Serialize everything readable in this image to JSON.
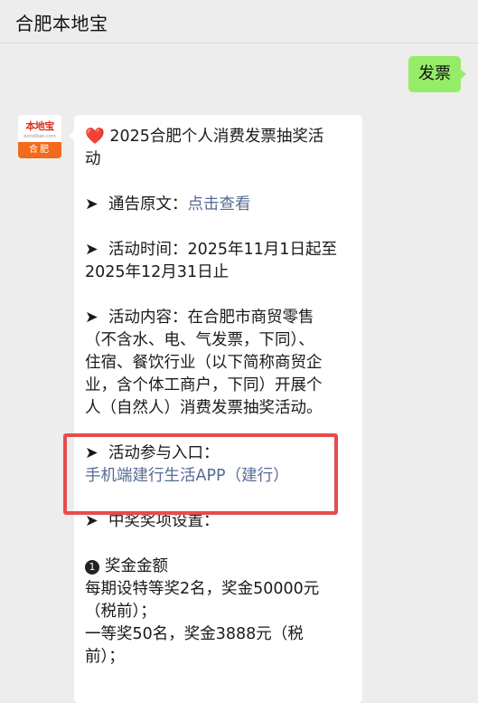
{
  "header": {
    "title": "合肥本地宝"
  },
  "outgoing": {
    "text": "发票"
  },
  "avatar": {
    "brand": "本地宝",
    "sub": "bendibao.com",
    "city": "合肥"
  },
  "message": {
    "title_line1": "2025合肥个人消费发票抽奖活",
    "title_line2": "动",
    "notice_prefix": "通告原文：",
    "notice_link": "点击查看",
    "time_line1": "活动时间：2025年11月1日起至",
    "time_line2": "2025年12月31日止",
    "content_line1": "活动内容：在合肥市商贸零售",
    "content_line2": "（不含水、电、气发票，下同）、",
    "content_line3": "住宿、餐饮行业（以下简称商贸企",
    "content_line4": "业，含个体工商户，下同）开展个",
    "content_line5": "人（自然人）消费发票抽奖活动。",
    "entry_label": "活动参与入口：",
    "entry_link": "手机端建行生活APP（建行）",
    "prize_heading": "中奖奖项设置：",
    "amount_marker": "1",
    "amount_title": "奖金金额",
    "prize_line1": "每期设特等奖2名，奖金50000元",
    "prize_line2": "（税前）；",
    "prize_line3": "一等奖50名，奖金3888元（税",
    "prize_line4": "前）；"
  },
  "colors": {
    "outgoing_bubble": "#95ec69",
    "link": "#576b95",
    "highlight": "#e74c4c",
    "background": "#ededed"
  },
  "icons": {
    "heart": "heart-icon",
    "arrow": "arrow-right-icon"
  }
}
